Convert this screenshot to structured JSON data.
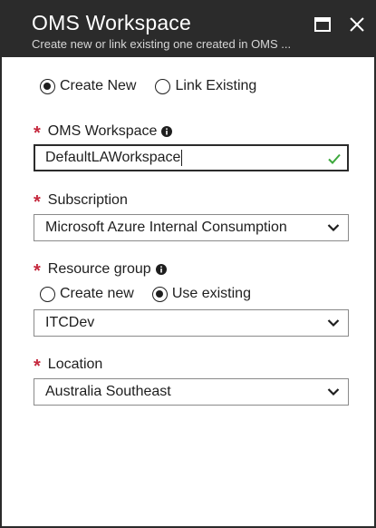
{
  "header": {
    "title": "OMS Workspace",
    "subtitle": "Create new or link existing one created in OMS ..."
  },
  "mode": {
    "options": [
      {
        "label": "Create New",
        "checked": true
      },
      {
        "label": "Link Existing",
        "checked": false
      }
    ]
  },
  "workspace": {
    "label": "OMS Workspace",
    "value": "DefaultLAWorkspace",
    "valid": true
  },
  "subscription": {
    "label": "Subscription",
    "value": "Microsoft Azure Internal Consumption"
  },
  "resource_group": {
    "label": "Resource group",
    "options": [
      {
        "label": "Create new",
        "checked": false
      },
      {
        "label": "Use existing",
        "checked": true
      }
    ],
    "value": "ITCDev"
  },
  "location": {
    "label": "Location",
    "value": "Australia Southeast"
  },
  "required_marker": "*",
  "colors": {
    "header_bg": "#2b2b2b",
    "required": "#c5283d",
    "valid_check": "#3ca83c"
  }
}
